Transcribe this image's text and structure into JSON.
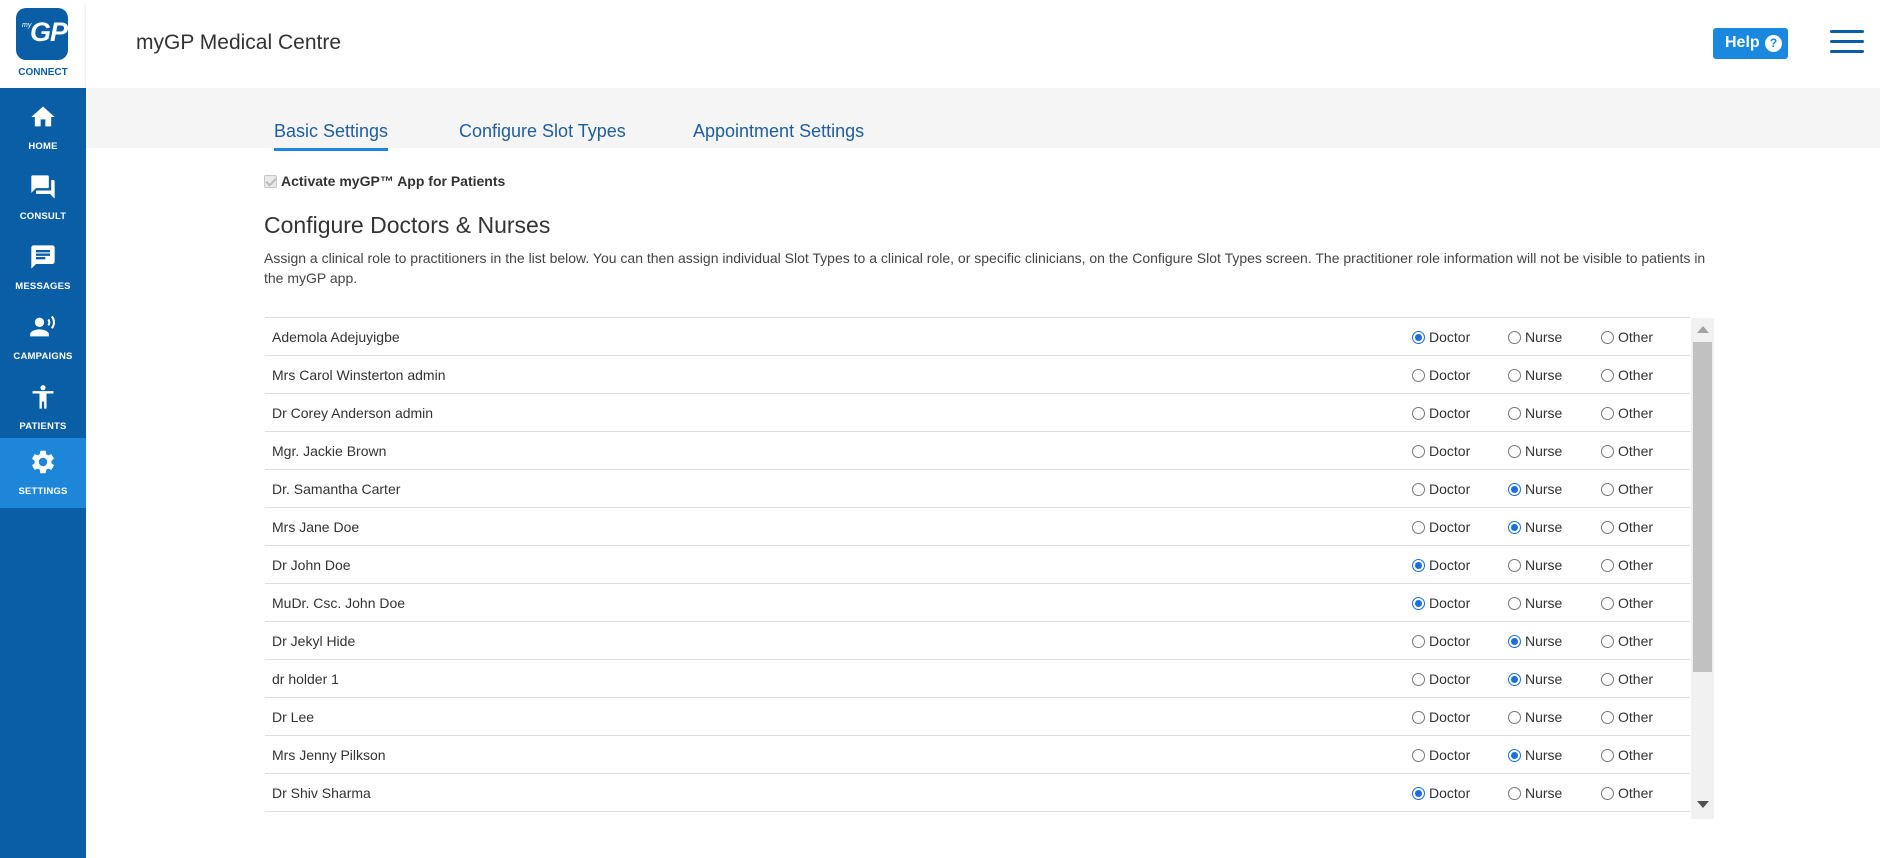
{
  "brand": {
    "logo_small": "my",
    "logo_main": "GP",
    "logo_sub": "CONNECT",
    "color": "#0a5ea5"
  },
  "sidebar": {
    "items": [
      {
        "label": "HOME",
        "icon": "home-icon",
        "active": false
      },
      {
        "label": "CONSULT",
        "icon": "chat-bubbles-icon",
        "active": false
      },
      {
        "label": "MESSAGES",
        "icon": "message-icon",
        "active": false
      },
      {
        "label": "CAMPAIGNS",
        "icon": "campaign-icon",
        "active": false
      },
      {
        "label": "PATIENTS",
        "icon": "person-icon",
        "active": false
      },
      {
        "label": "SETTINGS",
        "icon": "gear-icon",
        "active": true
      }
    ]
  },
  "header": {
    "title": "myGP Medical Centre",
    "help_label": "Help",
    "help_icon": "question-icon",
    "menu_icon": "hamburger-menu-icon"
  },
  "tabs": [
    {
      "label": "Basic Settings",
      "active": true
    },
    {
      "label": "Configure Slot Types",
      "active": false
    },
    {
      "label": "Appointment Settings",
      "active": false
    }
  ],
  "activate": {
    "label": "Activate myGP™ App for Patients",
    "checked": true,
    "disabled": true
  },
  "section": {
    "title": "Configure Doctors & Nurses",
    "description": "Assign a clinical role to practitioners in the list below. You can then assign individual Slot Types to a clinical role, or specific clinicians, on the Configure Slot Types screen. The practitioner role information will not be visible to patients in the myGP app."
  },
  "role_labels": {
    "doctor": "Doctor",
    "nurse": "Nurse",
    "other": "Other"
  },
  "practitioners": [
    {
      "name": "Ademola Adejuyigbe",
      "role": "doctor"
    },
    {
      "name": "Mrs Carol Winsterton admin",
      "role": "none"
    },
    {
      "name": "Dr Corey Anderson admin",
      "role": "none"
    },
    {
      "name": "Mgr. Jackie Brown",
      "role": "none"
    },
    {
      "name": "Dr. Samantha Carter",
      "role": "nurse"
    },
    {
      "name": "Mrs Jane Doe",
      "role": "nurse"
    },
    {
      "name": "Dr John Doe",
      "role": "doctor"
    },
    {
      "name": "MuDr. Csc. John Doe",
      "role": "doctor"
    },
    {
      "name": "Dr Jekyl Hide",
      "role": "nurse"
    },
    {
      "name": "dr holder 1",
      "role": "nurse"
    },
    {
      "name": "Dr Lee",
      "role": "none"
    },
    {
      "name": "Mrs Jenny Pilkson",
      "role": "nurse"
    },
    {
      "name": "Dr Shiv Sharma",
      "role": "doctor"
    }
  ]
}
